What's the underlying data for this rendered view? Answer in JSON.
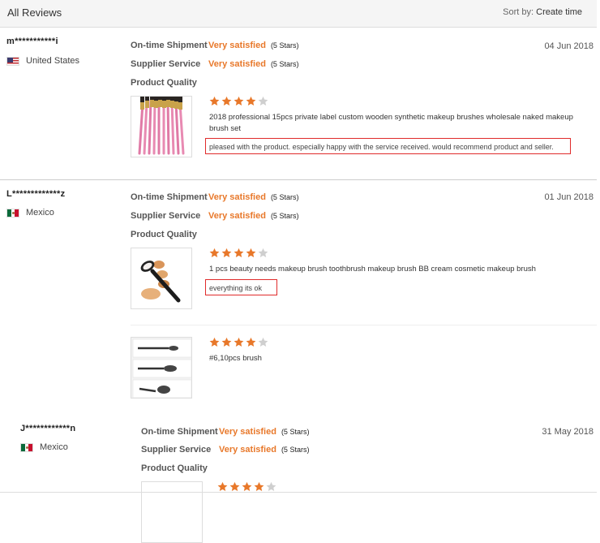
{
  "header": {
    "title": "All Reviews",
    "sort_label": "Sort by:",
    "sort_value": "Create time"
  },
  "colors": {
    "accent": "#e8782a",
    "star_filled": "#e8782a",
    "star_empty": "#cfcfcf",
    "highlight_box": "#e02b2b"
  },
  "labels": {
    "shipment": "On-time Shipment",
    "service": "Supplier Service",
    "quality": "Product Quality"
  },
  "reviews": [
    {
      "user": "m***********i",
      "country": "United States",
      "flag": "us-flag-icon",
      "date": "04 Jun 2018",
      "shipment": "Very satisfied",
      "shipment_stars": "(5 Stars)",
      "service": "Very satisfied",
      "service_stars": "(5 Stars)",
      "items": [
        {
          "rating": 4,
          "product": "2018 professional 15pcs private label custom wooden synthetic makeup brushes wholesale naked makeup brush set",
          "comment": "pleased with the product. especially happy with the service received. would recommend product and seller."
        }
      ]
    },
    {
      "user": "L*************z",
      "country": "Mexico",
      "flag": "mexico-flag-icon",
      "date": "01 Jun 2018",
      "shipment": "Very satisfied",
      "shipment_stars": "(5 Stars)",
      "service": "Very satisfied",
      "service_stars": "(5 Stars)",
      "items": [
        {
          "rating": 4,
          "product": "1 pcs beauty needs makeup brush toothbrush makeup brush BB cream cosmetic makeup brush",
          "comment": "everything its ok"
        },
        {
          "rating": 4,
          "product": "#6,10pcs brush",
          "comment": ""
        }
      ]
    },
    {
      "user": "J************n",
      "country": "Mexico",
      "flag": "mexico-flag-icon",
      "date": "31 May 2018",
      "shipment": "Very satisfied",
      "shipment_stars": "(5 Stars)",
      "service": "Very satisfied",
      "service_stars": "(5 Stars)",
      "items": [
        {
          "rating": 4,
          "product": "",
          "comment": ""
        }
      ]
    }
  ]
}
